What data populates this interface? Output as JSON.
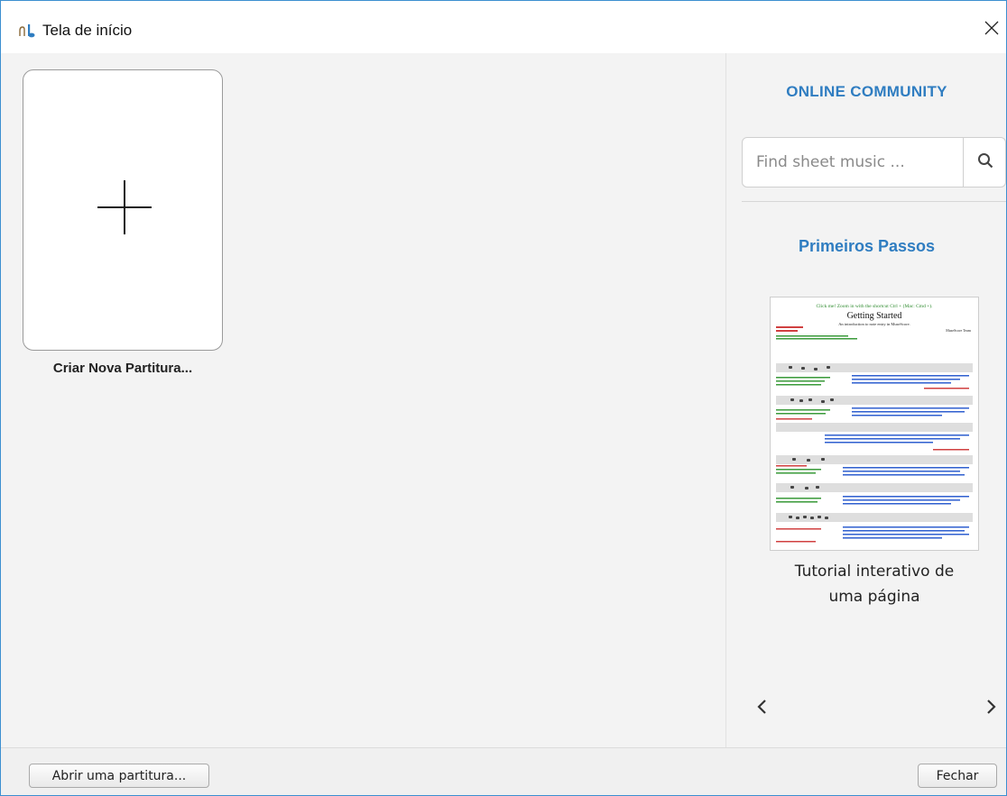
{
  "window": {
    "title": "Tela de início",
    "icon": "musescore-app-icon",
    "close_icon": "close-icon"
  },
  "main": {
    "new_score": {
      "label": "Criar Nova Partitura...",
      "icon": "plus-icon"
    }
  },
  "sidebar": {
    "community_title": "ONLINE COMMUNITY",
    "search": {
      "placeholder": "Find sheet music ...",
      "value": "",
      "icon": "search-icon"
    },
    "getting_started_title": "Primeiros Passos",
    "tutorial": {
      "caption_line1": "Tutorial interativo de",
      "caption_line2": "uma página",
      "thumbnail": {
        "header": "Click me! Zoom in with the shortcut Ctrl + (Mac: Cmd +).",
        "title": "Getting Started",
        "subtitle": "An introduction to note entry in MuseScore.",
        "composer": "MuseScore Team"
      }
    },
    "prev_icon": "chevron-left-icon",
    "next_icon": "chevron-right-icon"
  },
  "footer": {
    "open_label": "Abrir uma partitura...",
    "close_label": "Fechar"
  },
  "colors": {
    "accent": "#2f7dc1",
    "window_border": "#3c8fd0",
    "background": "#f3f3f3"
  }
}
